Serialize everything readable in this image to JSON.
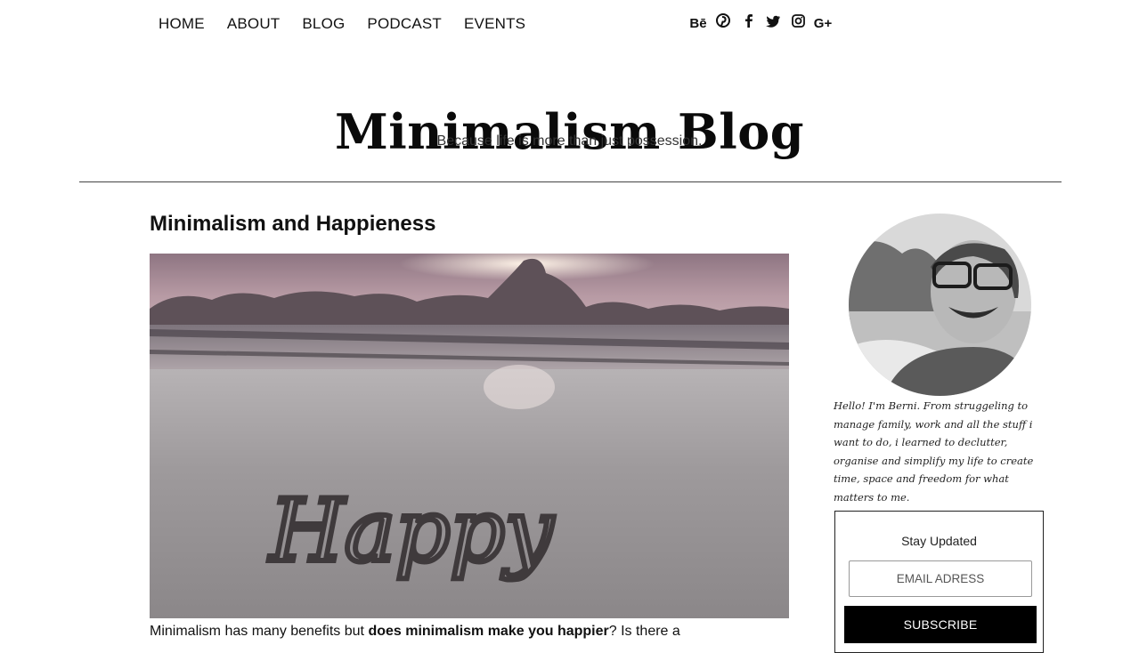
{
  "nav": {
    "items": [
      {
        "label": "HOME"
      },
      {
        "label": "ABOUT"
      },
      {
        "label": "BLOG"
      },
      {
        "label": "PODCAST"
      },
      {
        "label": "EVENTS"
      }
    ]
  },
  "social": {
    "icons": [
      {
        "name": "behance-icon",
        "glyph": "Bē"
      },
      {
        "name": "pinterest-icon",
        "glyph": "℗"
      },
      {
        "name": "facebook-icon",
        "glyph": "f"
      },
      {
        "name": "twitter-icon",
        "glyph": "🐦"
      },
      {
        "name": "instagram-icon",
        "glyph": "◎"
      },
      {
        "name": "google-plus-icon",
        "glyph": "G+"
      }
    ]
  },
  "header": {
    "title": "Minimalism Blog",
    "tagline": "Because life is more than just possession."
  },
  "post": {
    "title": "Minimalism and Happieness",
    "image_text": "Happy",
    "excerpt_start": "Minimalism has many benefits but ",
    "excerpt_bold": "does minimalism make you happier",
    "excerpt_end": "? Is there a"
  },
  "sidebar": {
    "bio": "Hello! I'm Berni. From struggeling to manage family, work and all the stuff i want to do, i learned to declutter, organise and simplify my life to create time, space and freedom for what matters to me.",
    "subscribe_title": "Stay Updated",
    "email_placeholder": "EMAIL ADRESS",
    "subscribe_label": "SUBSCRIBE"
  },
  "colors": {
    "text": "#111111",
    "button_bg": "#000000",
    "divider": "#444444"
  }
}
